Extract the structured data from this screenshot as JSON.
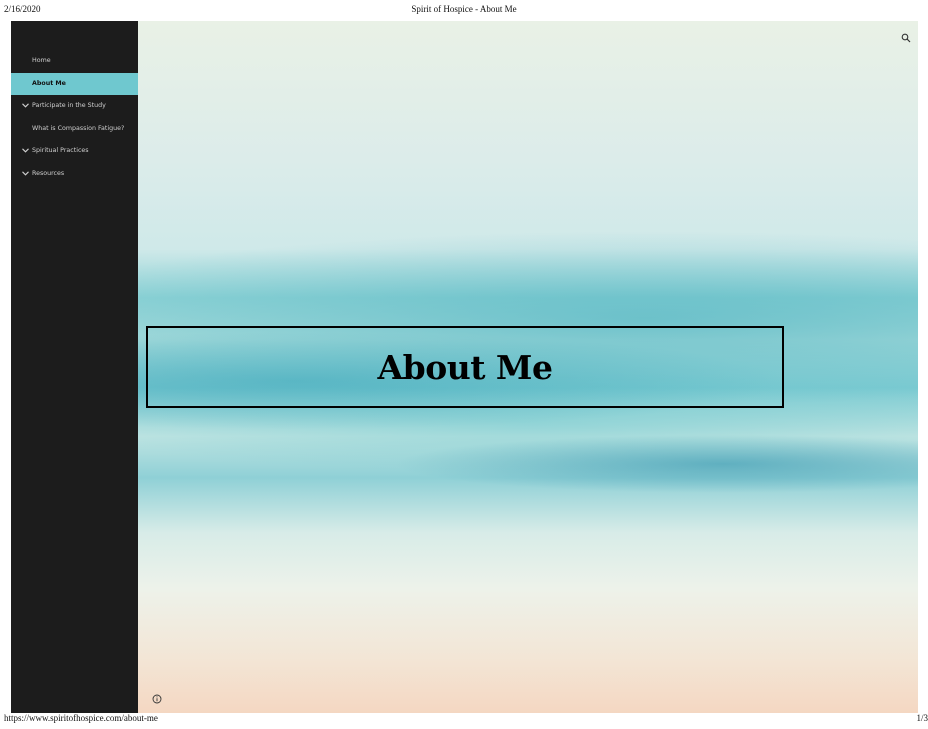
{
  "print": {
    "date": "2/16/2020",
    "title": "Spirit of Hospice - About Me",
    "url": "https://www.spiritofhospice.com/about-me",
    "page": "1/3"
  },
  "sidebar": {
    "items": [
      {
        "label": "Home",
        "active": false,
        "has_submenu": false
      },
      {
        "label": "About Me",
        "active": true,
        "has_submenu": false
      },
      {
        "label": "Participate in the Study",
        "active": false,
        "has_submenu": true
      },
      {
        "label": "What is Compassion Fatigue?",
        "active": false,
        "has_submenu": false
      },
      {
        "label": "Spiritual Practices",
        "active": false,
        "has_submenu": true
      },
      {
        "label": "Resources",
        "active": false,
        "has_submenu": true
      }
    ]
  },
  "hero": {
    "title": "About Me"
  },
  "icons": {
    "search": "search-icon",
    "info": "info-icon",
    "chevron": "chevron-down-icon"
  },
  "colors": {
    "sidebar_bg": "#1c1c1c",
    "active_bg": "#6fc8cf",
    "sidebar_text": "#cfcfcf"
  }
}
